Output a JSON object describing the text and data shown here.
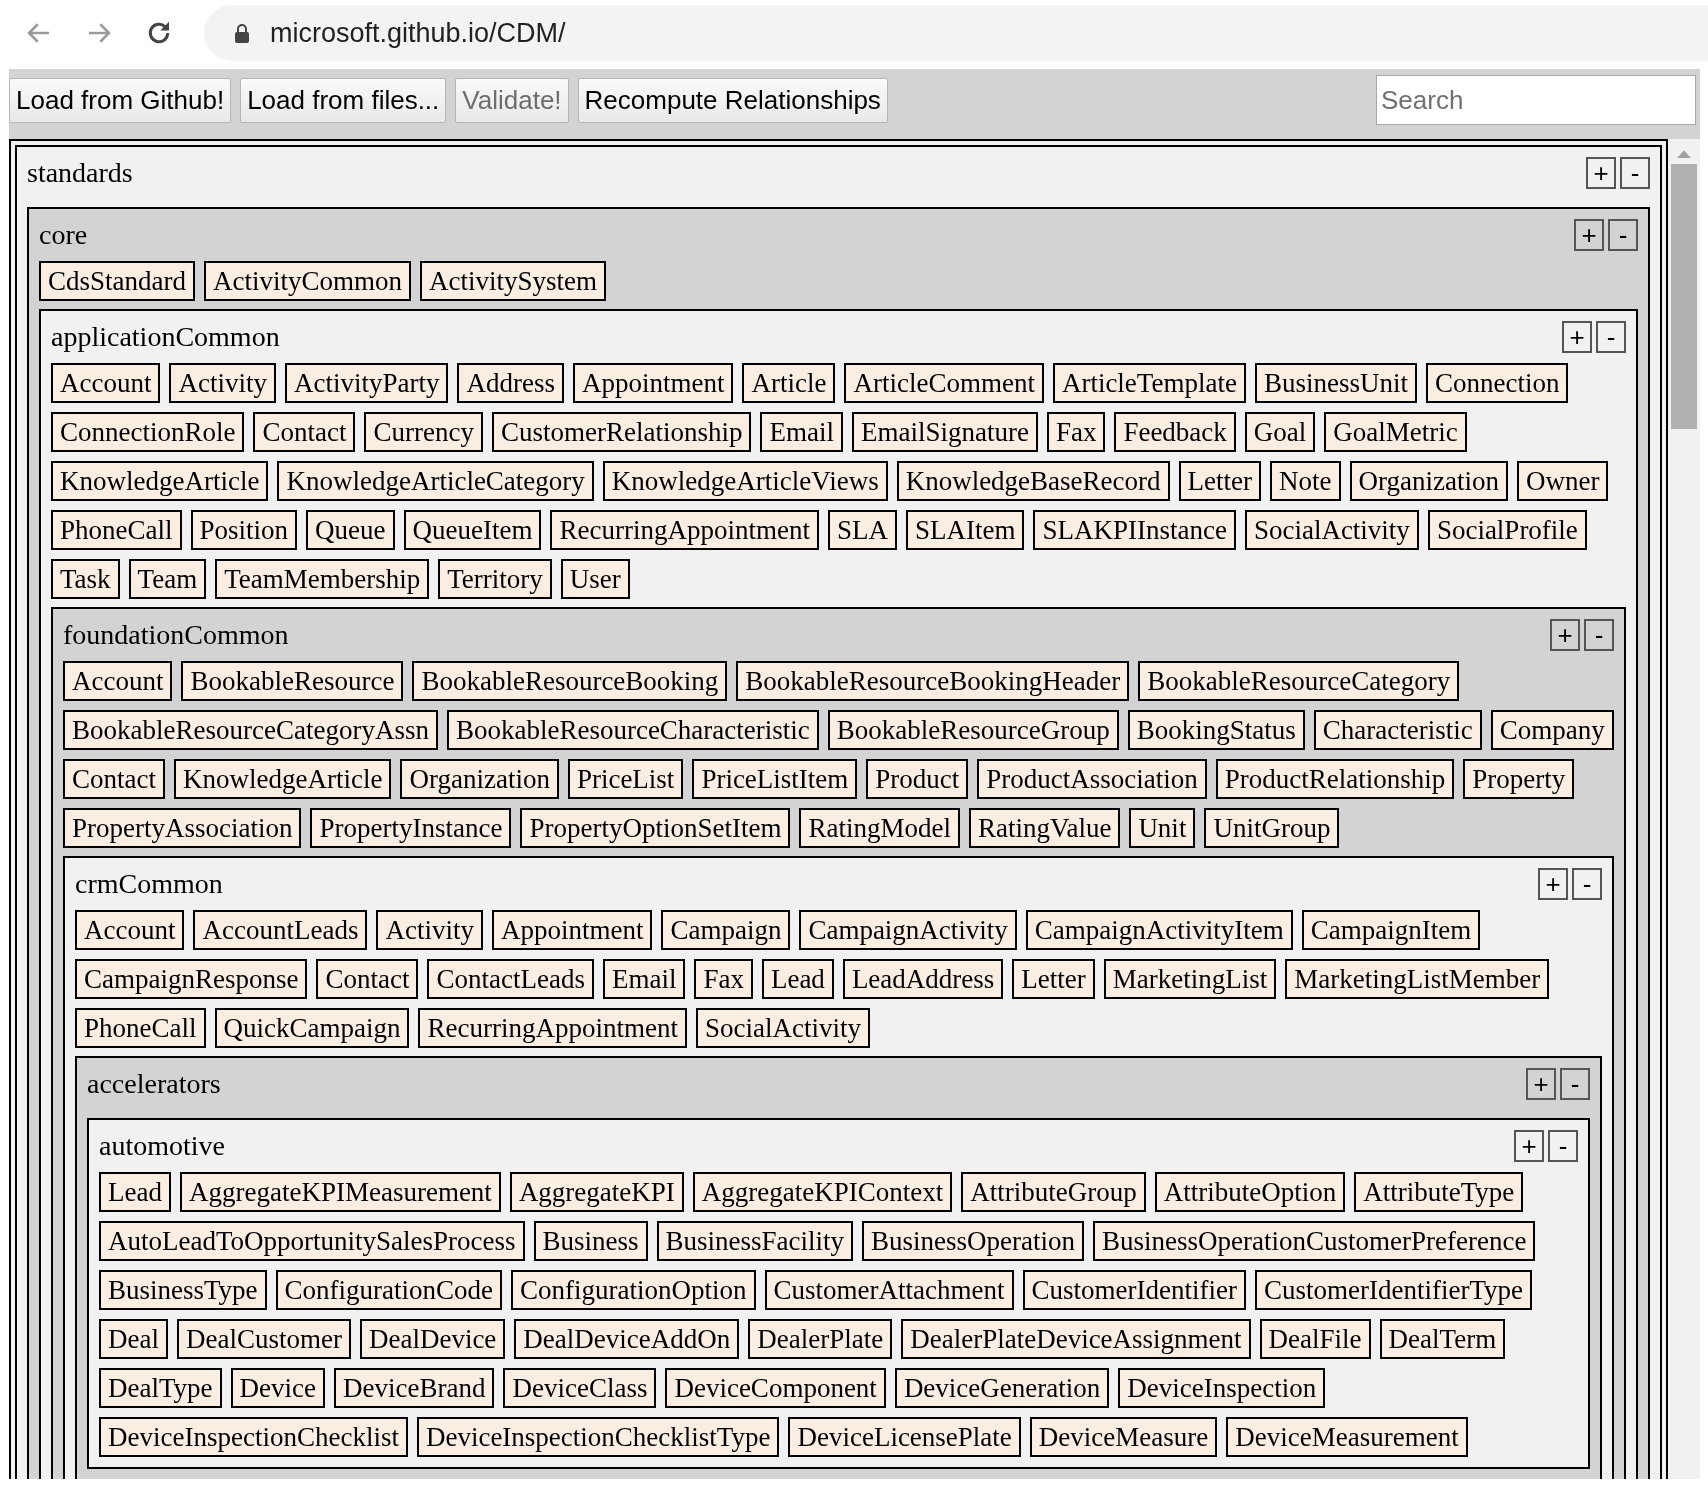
{
  "browser": {
    "url": "microsoft.github.io/CDM/"
  },
  "toolbar": {
    "buttons": [
      {
        "label": "Load from Github!",
        "disabled": false
      },
      {
        "label": "Load from files...",
        "disabled": false
      },
      {
        "label": "Validate!",
        "disabled": true
      },
      {
        "label": "Recompute Relationships",
        "disabled": false
      }
    ],
    "search": {
      "placeholder": "Search"
    }
  },
  "tree": [
    {
      "name": "standards",
      "expand_label": "+",
      "collapse_label": "-",
      "children": [
        {
          "name": "core",
          "expand_label": "+",
          "collapse_label": "-",
          "entities": [
            "CdsStandard",
            "ActivityCommon",
            "ActivitySystem"
          ],
          "children": [
            {
              "name": "applicationCommon",
              "expand_label": "+",
              "collapse_label": "-",
              "entities": [
                "Account",
                "Activity",
                "ActivityParty",
                "Address",
                "Appointment",
                "Article",
                "ArticleComment",
                "ArticleTemplate",
                "BusinessUnit",
                "Connection",
                "ConnectionRole",
                "Contact",
                "Currency",
                "CustomerRelationship",
                "Email",
                "EmailSignature",
                "Fax",
                "Feedback",
                "Goal",
                "GoalMetric",
                "KnowledgeArticle",
                "KnowledgeArticleCategory",
                "KnowledgeArticleViews",
                "KnowledgeBaseRecord",
                "Letter",
                "Note",
                "Organization",
                "Owner",
                "PhoneCall",
                "Position",
                "Queue",
                "QueueItem",
                "RecurringAppointment",
                "SLA",
                "SLAItem",
                "SLAKPIInstance",
                "SocialActivity",
                "SocialProfile",
                "Task",
                "Team",
                "TeamMembership",
                "Territory",
                "User"
              ],
              "children": [
                {
                  "name": "foundationCommon",
                  "expand_label": "+",
                  "collapse_label": "-",
                  "entities": [
                    "Account",
                    "BookableResource",
                    "BookableResourceBooking",
                    "BookableResourceBookingHeader",
                    "BookableResourceCategory",
                    "BookableResourceCategoryAssn",
                    "BookableResourceCharacteristic",
                    "BookableResourceGroup",
                    "BookingStatus",
                    "Characteristic",
                    "Company",
                    "Contact",
                    "KnowledgeArticle",
                    "Organization",
                    "PriceList",
                    "PriceListItem",
                    "Product",
                    "ProductAssociation",
                    "ProductRelationship",
                    "Property",
                    "PropertyAssociation",
                    "PropertyInstance",
                    "PropertyOptionSetItem",
                    "RatingModel",
                    "RatingValue",
                    "Unit",
                    "UnitGroup"
                  ],
                  "children": [
                    {
                      "name": "crmCommon",
                      "expand_label": "+",
                      "collapse_label": "-",
                      "entities": [
                        "Account",
                        "AccountLeads",
                        "Activity",
                        "Appointment",
                        "Campaign",
                        "CampaignActivity",
                        "CampaignActivityItem",
                        "CampaignItem",
                        "CampaignResponse",
                        "Contact",
                        "ContactLeads",
                        "Email",
                        "Fax",
                        "Lead",
                        "LeadAddress",
                        "Letter",
                        "MarketingList",
                        "MarketingListMember",
                        "PhoneCall",
                        "QuickCampaign",
                        "RecurringAppointment",
                        "SocialActivity"
                      ],
                      "children": [
                        {
                          "name": "accelerators",
                          "expand_label": "+",
                          "collapse_label": "-",
                          "children": [
                            {
                              "name": "automotive",
                              "expand_label": "+",
                              "collapse_label": "-",
                              "entities": [
                                "Lead",
                                "AggregateKPIMeasurement",
                                "AggregateKPI",
                                "AggregateKPIContext",
                                "AttributeGroup",
                                "AttributeOption",
                                "AttributeType",
                                "AutoLeadToOpportunitySalesProcess",
                                "Business",
                                "BusinessFacility",
                                "BusinessOperation",
                                "BusinessOperationCustomerPreference",
                                "BusinessType",
                                "ConfigurationCode",
                                "ConfigurationOption",
                                "CustomerAttachment",
                                "CustomerIdentifier",
                                "CustomerIdentifierType",
                                "Deal",
                                "DealCustomer",
                                "DealDevice",
                                "DealDeviceAddOn",
                                "DealerPlate",
                                "DealerPlateDeviceAssignment",
                                "DealFile",
                                "DealTerm",
                                "DealType",
                                "Device",
                                "DeviceBrand",
                                "DeviceClass",
                                "DeviceComponent",
                                "DeviceGeneration",
                                "DeviceInspection",
                                "DeviceInspectionChecklist",
                                "DeviceInspectionChecklistType",
                                "DeviceLicensePlate",
                                "DeviceMeasure",
                                "DeviceMeasurement"
                              ]
                            }
                          ]
                        }
                      ]
                    }
                  ]
                }
              ]
            }
          ]
        }
      ]
    }
  ]
}
